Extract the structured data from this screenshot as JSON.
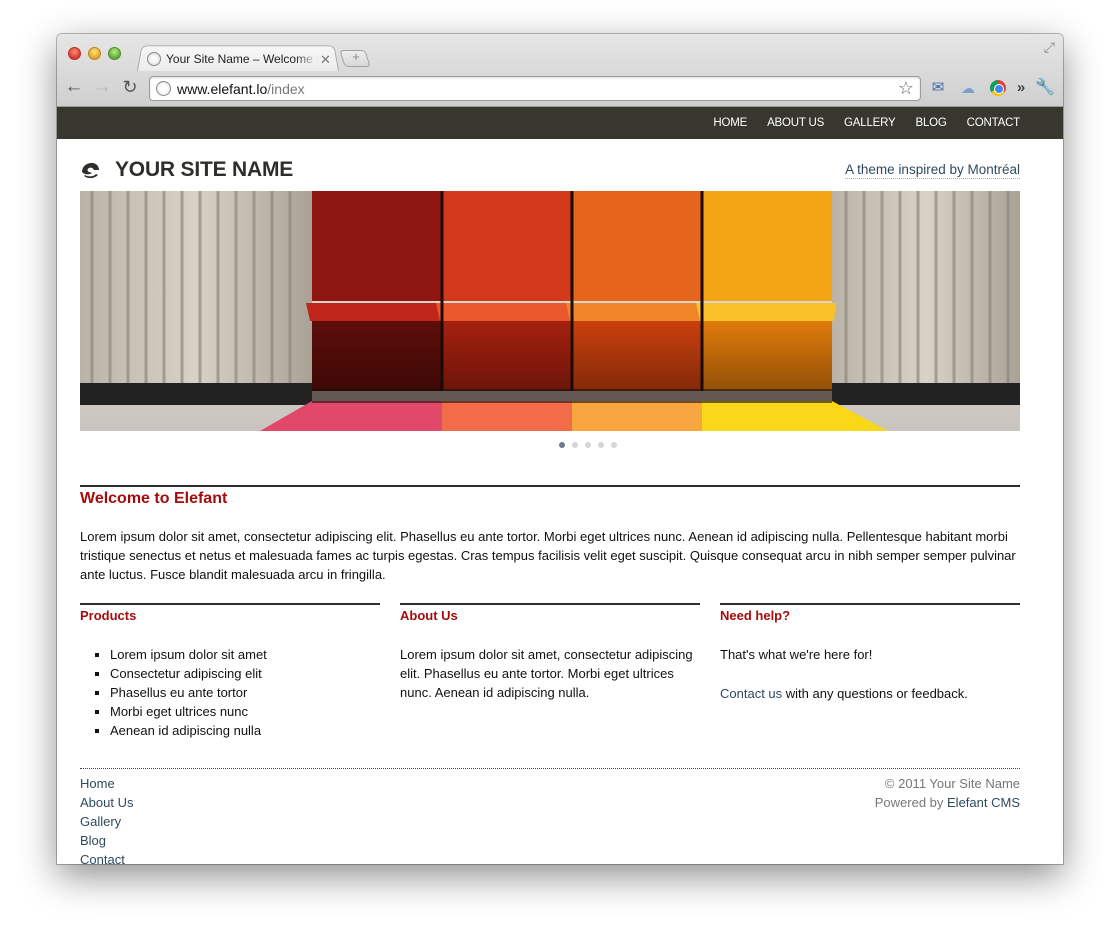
{
  "browser": {
    "tab_title": "Your Site Name – Welcome to Elefant",
    "url_host": "www.elefant.lo",
    "url_path": "/index"
  },
  "site": {
    "nav": [
      "HOME",
      "ABOUT US",
      "GALLERY",
      "BLOG",
      "CONTACT"
    ],
    "name": "YOUR SITE NAME",
    "tagline": "A theme inspired by Montréal"
  },
  "slider": {
    "dot_count": 5,
    "active_index": 0
  },
  "welcome": {
    "title": "Welcome to Elefant",
    "body": "Lorem ipsum dolor sit amet, consectetur adipiscing elit. Phasellus eu ante tortor. Morbi eget ultrices nunc. Aenean id adipiscing nulla. Pellentesque habitant morbi tristique senectus et netus et malesuada fames ac turpis egestas. Cras tempus facilisis velit eget suscipit. Quisque consequat arcu in nibh semper semper pulvinar ante luctus. Fusce blandit malesuada arcu in fringilla."
  },
  "columns": {
    "products": {
      "title": "Products",
      "items": [
        "Lorem ipsum dolor sit amet",
        "Consectetur adipiscing elit",
        "Phasellus eu ante tortor",
        "Morbi eget ultrices nunc",
        "Aenean id adipiscing nulla"
      ]
    },
    "about": {
      "title": "About Us",
      "body": "Lorem ipsum dolor sit amet, consectetur adipiscing elit. Phasellus eu ante tortor. Morbi eget ultrices nunc. Aenean id adipiscing nulla."
    },
    "help": {
      "title": "Need help?",
      "line1": "That's what we're here for!",
      "contact_link": "Contact us",
      "line2_rest": " with any questions or feedback."
    }
  },
  "footer": {
    "links": [
      "Home",
      "About Us",
      "Gallery",
      "Blog",
      "Contact"
    ],
    "copyright": "© 2011 Your Site Name",
    "powered_prefix": "Powered by ",
    "powered_link": "Elefant CMS"
  },
  "colors": {
    "nav_bg": "#37362f",
    "heading_red": "#a50d0d",
    "link_blue": "#2e4b5e"
  }
}
